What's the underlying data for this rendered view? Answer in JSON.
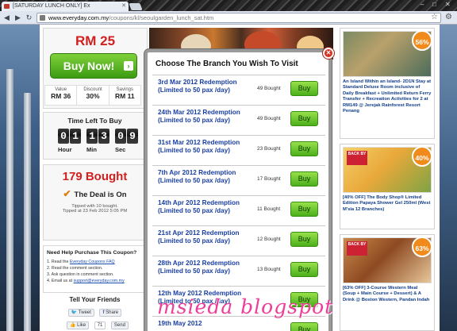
{
  "browser": {
    "tab_title": "[SATURDAY LUNCH ONLY] Ex",
    "url_host": "www.everyday.com.my",
    "url_path": "/coupons/kl/seoulgarden_lunch_sat.htm"
  },
  "deal": {
    "price": "RM 25",
    "buy_now_label": "Buy Now!",
    "value_label": "Value",
    "value": "RM 36",
    "discount_label": "Discount",
    "discount": "30%",
    "savings_label": "Savings",
    "savings": "RM 11",
    "time_left_label": "Time Left To Buy",
    "hours": "01",
    "minutes": "13",
    "seconds": "09",
    "hour_label": "Hour",
    "min_label": "Min",
    "sec_label": "Sec",
    "bought_text": "179 Bought",
    "deal_on_text": "The Deal is On",
    "tipped_with": "Tipped with 10 bought.",
    "tipped_at": "Tipped at 23 Feb 2012 5:05 PM"
  },
  "help": {
    "heading": "Need Help Purchase This Coupon?",
    "step1_prefix": "1. Read the ",
    "step1_link": "Everyday Coupons FAQ",
    "step2": "2. Read the comment section.",
    "step3": "3. Ask question in comment section.",
    "step4_prefix": "4. Email us at ",
    "step4_link": "support@everyday.com.my"
  },
  "share": {
    "heading": "Tell Your Friends",
    "tweet": "Tweet",
    "share": "Share",
    "like": "Like",
    "like_count": "71",
    "send": "Send"
  },
  "sidebar": {
    "cards": [
      {
        "pct": "56%",
        "text": "An Island Within an Island- 2D1N Stay at Standard Deluxe Room inclusive of Daily Breakfast + Unlimited Return Ferry Transfer + Recreation Activities for 2 at RM149 @ Jerejak Rainforest Resort Penang"
      },
      {
        "pct": "40%",
        "text": "[40% OFF] The Body Shop® Limited Edition Papaya Shower Gel 250ml (West M'sia 12 Branches)"
      },
      {
        "pct": "63%",
        "text": "[63% OFF] 3-Course Western Meal (Soup + Main Course + Dessert) & A Drink @ Boston Western, Pandan Indah"
      }
    ]
  },
  "modal": {
    "title": "Choose The Branch You Wish To Visit",
    "buy_label": "Buy",
    "items": [
      {
        "label": "3rd Mar 2012 Redemption (Limited to 50 pax /day)",
        "count": "49 Bought"
      },
      {
        "label": "24th Mar 2012 Redemption (Limited to 50 pax /day)",
        "count": "49 Bought"
      },
      {
        "label": "31st Mar 2012 Redemption (Limited to 50 pax /day)",
        "count": "23 Bought"
      },
      {
        "label": "7th Apr 2012 Redemption (Limited to 50 pax /day)",
        "count": "17 Bought"
      },
      {
        "label": "14th Apr 2012 Redemption (Limited to 50 pax /day)",
        "count": "11 Bought"
      },
      {
        "label": "21st Apr 2012 Redemption (Limited to 50 pax /day)",
        "count": "12 Bought"
      },
      {
        "label": "28th Apr 2012 Redemption (Limited to 50 pax /day)",
        "count": "13 Bought"
      },
      {
        "label": "12th May 2012 Redemption (Limited to 50 pax /day)",
        "count": ""
      },
      {
        "label": "19th May 2012",
        "count": ""
      }
    ]
  },
  "watermark": "msieda blogspot"
}
